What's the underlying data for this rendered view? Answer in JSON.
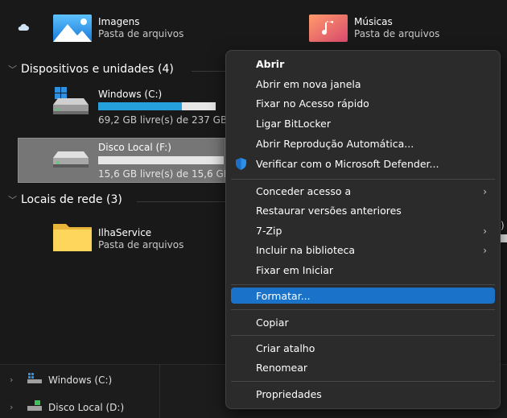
{
  "quick_access": {
    "imagens": {
      "label": "Imagens",
      "sub": "Pasta de arquivos"
    },
    "musicas": {
      "label": "Músicas",
      "sub": "Pasta de arquivos"
    }
  },
  "devices_group": {
    "label": "Dispositivos e unidades (4)"
  },
  "drives": [
    {
      "label": "Windows (C:)",
      "free": "69,2 GB livre(s) de 237 GB",
      "used_fraction": 0.71,
      "bar_color": "#26a0da"
    },
    {
      "label": "Disco Local (F:)",
      "free": "15,6 GB livre(s) de 15,6 GB",
      "used_fraction": 0.0,
      "bar_color": "#26a0da"
    }
  ],
  "network_group": {
    "label": "Locais de rede (3)"
  },
  "network_items": [
    {
      "label": "IlhaService",
      "sub": "Pasta de arquivos"
    }
  ],
  "nav_pane": [
    {
      "label": "Windows (C:)",
      "icon": "drive-icon"
    },
    {
      "label": "Disco Local (D:)",
      "icon": "drive-icon"
    }
  ],
  "context_menu": {
    "items": [
      {
        "label": "Abrir",
        "bold": true
      },
      {
        "label": "Abrir em nova janela"
      },
      {
        "label": "Fixar no Acesso rápido"
      },
      {
        "label": "Ligar BitLocker"
      },
      {
        "label": "Abrir Reprodução Automática..."
      },
      {
        "label": "Verificar com o Microsoft Defender...",
        "icon": "shield-icon"
      },
      {
        "label": "Conceder acesso a",
        "submenu": true
      },
      {
        "label": "Restaurar versões anteriores"
      },
      {
        "label": "7-Zip",
        "submenu": true
      },
      {
        "label": "Incluir na biblioteca",
        "submenu": true
      },
      {
        "label": "Fixar em Iniciar"
      },
      {
        "label": "Formatar...",
        "highlighted": true
      },
      {
        "label": "Copiar"
      },
      {
        "label": "Criar atalho"
      },
      {
        "label": "Renomear"
      },
      {
        "label": "Propriedades"
      }
    ],
    "highlight_color": "#1a72c9"
  }
}
